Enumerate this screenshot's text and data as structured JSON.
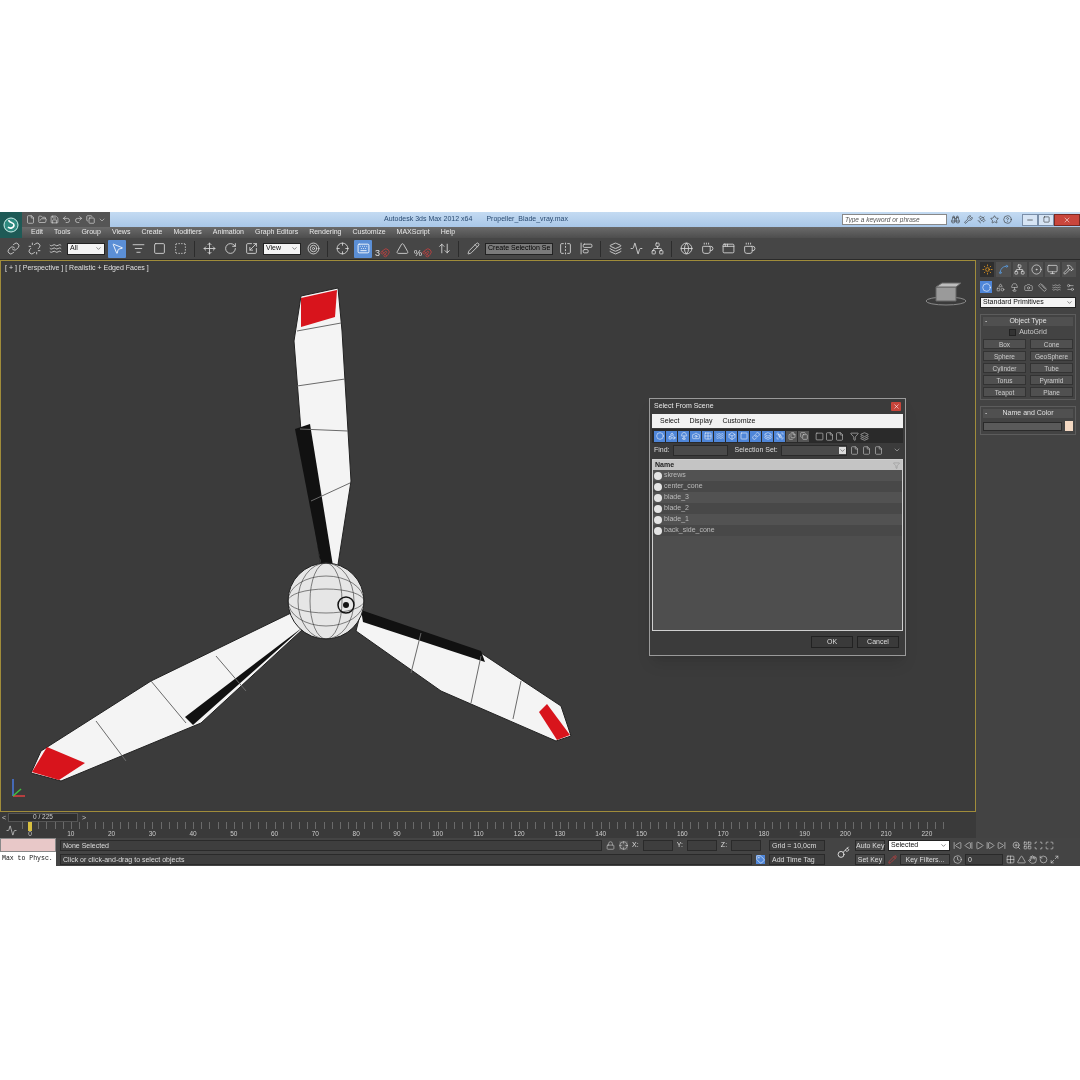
{
  "title_bar": {
    "app": "Autodesk 3ds Max 2012 x64",
    "file": "Propeller_Blade_vray.max",
    "search": {
      "placeholder": "Type a keyword or phrase"
    }
  },
  "menu": [
    "Edit",
    "Tools",
    "Group",
    "Views",
    "Create",
    "Modifiers",
    "Animation",
    "Graph Editors",
    "Rendering",
    "Customize",
    "MAXScript",
    "Help"
  ],
  "toolbar": [
    {
      "kind": "button",
      "selected": false
    },
    {
      "kind": "button",
      "selected": false
    },
    {
      "kind": "button",
      "selected": false
    },
    {
      "kind": "dropdown",
      "value": "All"
    },
    {
      "kind": "button",
      "selected": true
    },
    {
      "kind": "button",
      "selected": false
    },
    {
      "kind": "button",
      "selected": false
    },
    {
      "kind": "button",
      "selected": false
    },
    {
      "kind": "separator"
    },
    {
      "kind": "button",
      "selected": false
    },
    {
      "kind": "button",
      "selected": false
    },
    {
      "kind": "button",
      "selected": false
    },
    {
      "kind": "dropdown",
      "value": "View"
    },
    {
      "kind": "button",
      "selected": false
    },
    {
      "kind": "separator"
    },
    {
      "kind": "button",
      "selected": false
    },
    {
      "kind": "button",
      "selected": true
    },
    {
      "kind": "snap",
      "label": "3"
    },
    {
      "kind": "button",
      "selected": false
    },
    {
      "kind": "snap",
      "label": "%"
    },
    {
      "kind": "button",
      "selected": false
    },
    {
      "kind": "separator"
    },
    {
      "kind": "button",
      "selected": false
    },
    {
      "kind": "combo",
      "value": "Create Selection Se"
    },
    {
      "kind": "button",
      "selected": false
    },
    {
      "kind": "button",
      "selected": false
    },
    {
      "kind": "separator"
    },
    {
      "kind": "button",
      "selected": false
    },
    {
      "kind": "button",
      "selected": false
    },
    {
      "kind": "button",
      "selected": false
    },
    {
      "kind": "separator"
    },
    {
      "kind": "button",
      "selected": false
    },
    {
      "kind": "button",
      "selected": false
    },
    {
      "kind": "button",
      "selected": false
    },
    {
      "kind": "button",
      "selected": false
    }
  ],
  "viewport": {
    "labels": [
      "[ + ]",
      "[ Perspective ]",
      "[ Realistic + Edged Faces ]"
    ]
  },
  "dialog": {
    "title": "Select From Scene",
    "menu": [
      "Select",
      "Display",
      "Customize"
    ],
    "filters": [
      {
        "selected": true
      },
      {
        "selected": true
      },
      {
        "selected": true
      },
      {
        "selected": true
      },
      {
        "selected": true
      },
      {
        "selected": true
      },
      {
        "selected": true
      },
      {
        "selected": true
      },
      {
        "selected": true
      },
      {
        "selected": true
      },
      {
        "selected": true
      },
      {
        "selected": false
      },
      {
        "selected": false
      }
    ],
    "find_label": "Find:",
    "selection_set_label": "Selection Set:",
    "column": "Name",
    "rows": [
      "skrews",
      "center_cone",
      "blade_3",
      "blade_2",
      "blade_1",
      "back_side_cone"
    ],
    "buttons": [
      "OK",
      "Cancel"
    ]
  },
  "command_panel": {
    "tabs": [
      {
        "selected": true
      },
      {
        "selected": false
      },
      {
        "selected": false
      },
      {
        "selected": false
      },
      {
        "selected": false
      },
      {
        "selected": false
      }
    ],
    "categories": [
      {
        "selected": true
      },
      {
        "selected": false
      },
      {
        "selected": false
      },
      {
        "selected": false
      },
      {
        "selected": false
      },
      {
        "selected": false
      },
      {
        "selected": false
      }
    ],
    "dropdown": "Standard Primitives",
    "rollouts": [
      {
        "kind": "object_type",
        "toggle": "-",
        "title": "Object Type",
        "autogrid": {
          "label": "AutoGrid",
          "checked": false
        },
        "buttons": [
          "Box",
          "Cone",
          "Sphere",
          "GeoSphere",
          "Cylinder",
          "Tube",
          "Torus",
          "Pyramid",
          "Teapot",
          "Plane"
        ]
      },
      {
        "kind": "name_color",
        "toggle": "-",
        "title": "Name and Color",
        "color": "#f3d8c2"
      }
    ]
  },
  "time_slider": {
    "prev": "<",
    "next": ">",
    "frame": "0 / 225",
    "level": 0
  },
  "ruler": {
    "ticks": [
      "0",
      "10",
      "20",
      "30",
      "40",
      "50",
      "60",
      "70",
      "80",
      "90",
      "100",
      "110",
      "120",
      "130",
      "140",
      "150",
      "160",
      "170",
      "180",
      "190",
      "200",
      "210",
      "220"
    ]
  },
  "status": {
    "listener": "Max to Physc.",
    "selection": "None Selected",
    "prompt": "Click or click-and-drag to select objects",
    "x": "X:",
    "y": "Y:",
    "z": "Z:",
    "grid": "Grid = 10,0cm",
    "time_tag": "Add Time Tag",
    "auto_key": "Auto Key",
    "key_mode": "Selected",
    "set_key": "Set Key",
    "key_filters": "Key Filters...",
    "current_frame": "0"
  }
}
